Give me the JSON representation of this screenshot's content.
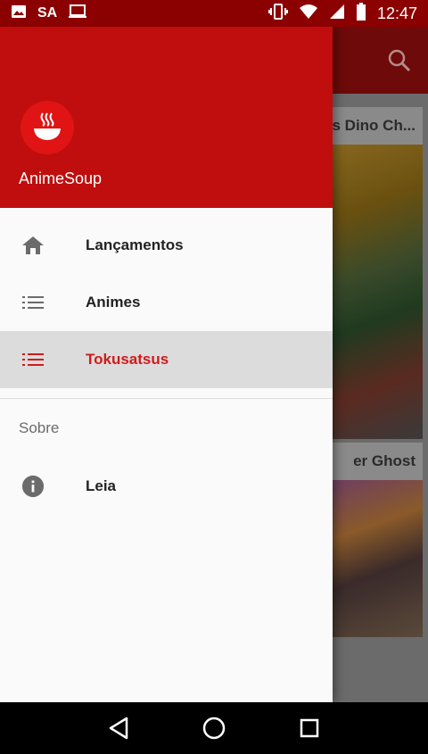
{
  "status_bar": {
    "carrier_text": "SA",
    "time": "12:47",
    "icons": [
      "image-icon",
      "laptop-icon",
      "vibrate-icon",
      "wifi-icon",
      "signal-icon",
      "battery-icon"
    ]
  },
  "background_app": {
    "cards": [
      {
        "title": "s Dino Ch..."
      },
      {
        "title": "er Ghost"
      }
    ]
  },
  "drawer": {
    "app_name": "AnimeSoup",
    "logo_icon": "soup-bowl-icon",
    "items": [
      {
        "label": "Lançamentos",
        "icon": "home-icon",
        "selected": false
      },
      {
        "label": "Animes",
        "icon": "list-icon",
        "selected": false
      },
      {
        "label": "Tokusatsus",
        "icon": "list-icon",
        "selected": true
      }
    ],
    "section_title": "Sobre",
    "about_items": [
      {
        "label": "Leia",
        "icon": "info-icon"
      }
    ]
  },
  "nav_bar": {
    "buttons": [
      "back-icon",
      "home-circle-icon",
      "recents-icon"
    ]
  },
  "colors": {
    "primary": "#c00d0d",
    "primary_dark": "#8b0000",
    "accent_selected": "#d11a1a"
  }
}
